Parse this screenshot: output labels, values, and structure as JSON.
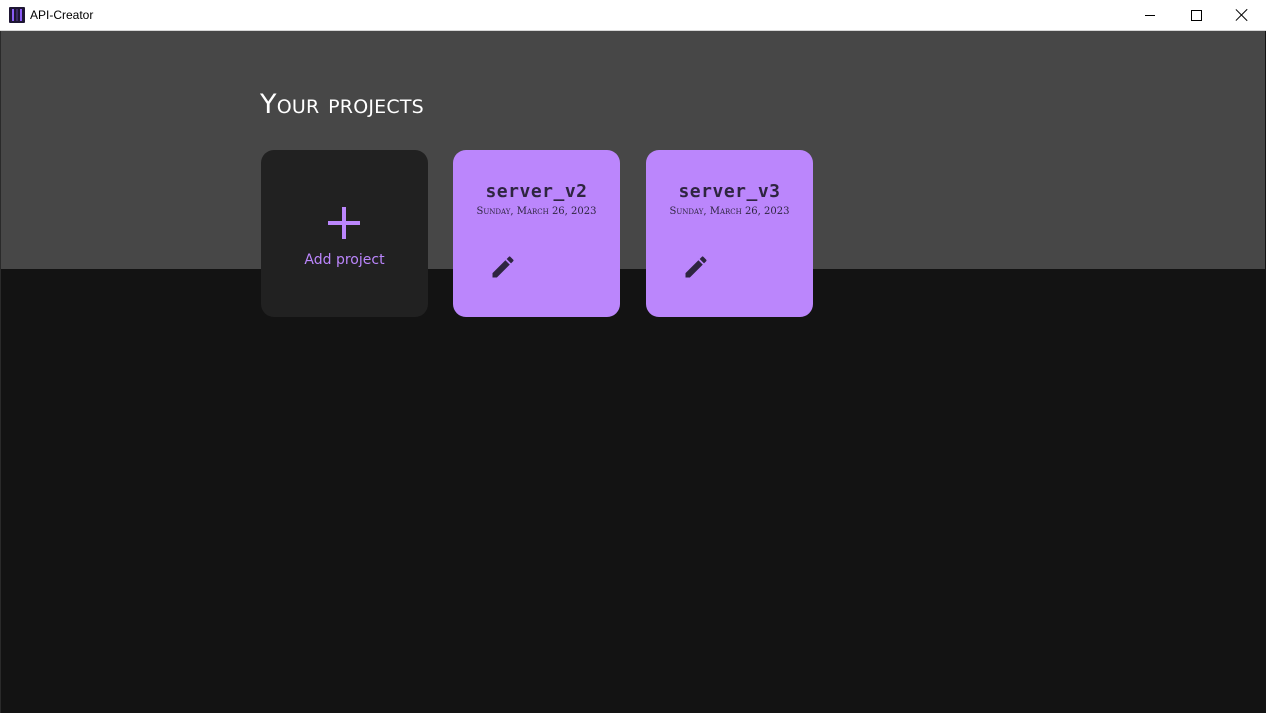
{
  "window": {
    "title": "API-Creator",
    "app_icon": "api-creator-logo-icon",
    "controls": [
      "minimize-icon",
      "maximize-icon",
      "close-icon"
    ]
  },
  "page": {
    "title": "Your projects"
  },
  "add_card": {
    "icon": "plus-icon",
    "label": "Add project"
  },
  "projects": [
    {
      "name": "server_v2",
      "date": "Sunday, March 26, 2023",
      "action_icon": "pencil-edit-icon"
    },
    {
      "name": "server_v3",
      "date": "Sunday, March 26, 2023",
      "action_icon": "pencil-edit-icon"
    }
  ],
  "colors": {
    "accent": "#bb86fc",
    "header_band": "#474747",
    "background": "#131313",
    "add_card_bg": "#212121",
    "card_text": "#2e2540"
  }
}
